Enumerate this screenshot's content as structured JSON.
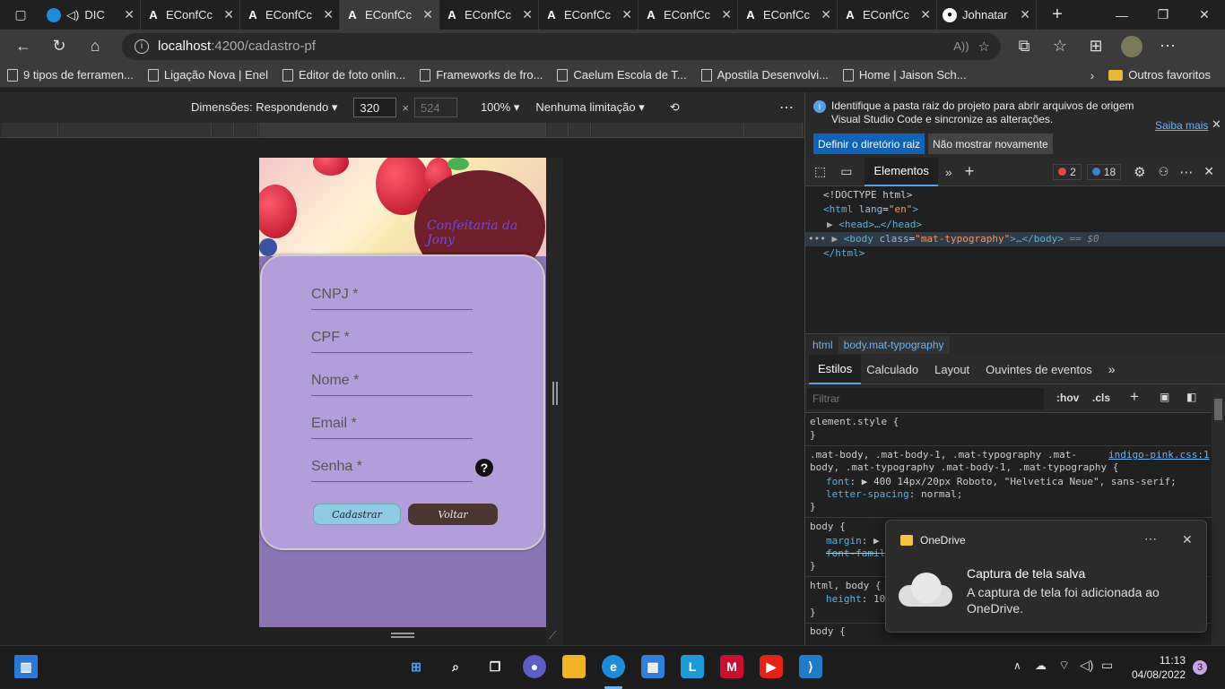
{
  "browser": {
    "tabs": [
      {
        "label": "DIC",
        "icon": "edge-icon"
      },
      {
        "label": "EConfCc",
        "icon": "angular-icon"
      },
      {
        "label": "EConfCc",
        "icon": "angular-icon"
      },
      {
        "label": "EConfCc",
        "icon": "angular-icon",
        "active": true
      },
      {
        "label": "EConfCc",
        "icon": "angular-icon"
      },
      {
        "label": "EConfCc",
        "icon": "angular-icon"
      },
      {
        "label": "EConfCc",
        "icon": "angular-icon"
      },
      {
        "label": "EConfCc",
        "icon": "angular-icon"
      },
      {
        "label": "EConfCc",
        "icon": "angular-icon"
      },
      {
        "label": "Johnatar",
        "icon": "github-icon"
      }
    ],
    "url_host": "localhost",
    "url_path": ":4200/cadastro-pf",
    "bookmarks": [
      "9 tipos de ferramen...",
      "Ligação Nova | Enel",
      "Editor de foto onlin...",
      "Frameworks de fro...",
      "Caelum Escola de T...",
      "Apostila Desenvolvi...",
      "Home | Jaison Sch..."
    ],
    "other_favorites": "Outros favoritos"
  },
  "device_toolbar": {
    "dimensions_label": "Dimensões: Respondendo",
    "width": "320",
    "times": "×",
    "height": "524",
    "zoom": "100%",
    "throttle": "Nenhuma limitação"
  },
  "app": {
    "brand": "Confeitaria da Jony",
    "fields": [
      {
        "label": "CNPJ *"
      },
      {
        "label": "CPF *"
      },
      {
        "label": "Nome *"
      },
      {
        "label": "Email *"
      },
      {
        "label": "Senha *"
      }
    ],
    "help": "?",
    "submit_label": "Cadastrar",
    "back_label": "Voltar"
  },
  "devtools": {
    "info_text_1": "Identifique a pasta raiz do projeto para abrir arquivos de origem",
    "info_text_2": "Visual Studio Code e sincronize as alterações.",
    "learn_more": "Saiba mais",
    "set_root_label": "Definir o diretório raiz",
    "dont_show_label": "Não mostrar novamente",
    "elements_tab": "Elementos",
    "errors_count": "2",
    "issues_count": "18",
    "dom": {
      "doctype": "<!DOCTYPE html>",
      "html_open_tag": "<html ",
      "html_attr": "lang",
      "html_attr_val": "\"en\"",
      "head": "<head>…</head>",
      "body_tag": "<body ",
      "body_attr": "class",
      "body_attr_val": "\"mat-typography\"",
      "body_rest": ">…</body>",
      "body_eq": "== $0",
      "html_close": "</html>"
    },
    "breadcrumbs": [
      "html",
      "body.mat-typography"
    ],
    "style_tabs": [
      "Estilos",
      "Calculado",
      "Layout",
      "Ouvintes de eventos"
    ],
    "filter_placeholder": "Filtrar",
    "hov": ":hov",
    "cls": ".cls",
    "styles": {
      "element_style": "element.style {",
      "close": "}",
      "rule2_sel_1": ".mat-body, .mat-body-1, .mat-typography .mat-",
      "rule2_sel_2": "body, .mat-typography .mat-body-1, .mat-typography {",
      "rule2_link": "indigo-pink.css:1",
      "font_prop": "font",
      "font_val": "400 14px/20px Roboto, \"Helvetica Neue\", sans-serif;",
      "ls_prop": "letter-spacing",
      "ls_val": "normal;",
      "body_sel": "body {",
      "margin_prop": "margin",
      "font_family_prop": "font-famil",
      "html_body_sel": "html, body {",
      "height_prop": "height",
      "height_val": "10",
      "body_sel2": "body {"
    }
  },
  "toast": {
    "app": "OneDrive",
    "title": "Captura de tela salva",
    "body_1": "A captura de tela foi adicionada ao",
    "body_2": "OneDrive."
  },
  "taskbar": {
    "time": "11:13",
    "date": "04/08/2022",
    "notifications": "3"
  }
}
